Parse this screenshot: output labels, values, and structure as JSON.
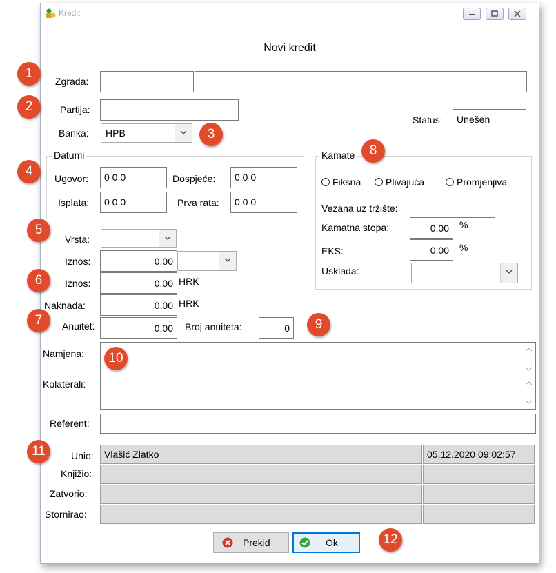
{
  "window": {
    "title": "Kredit",
    "heading": "Novi kredit"
  },
  "form": {
    "zgrada_label": "Zgrada:",
    "partija_label": "Partija:",
    "banka_label": "Banka:",
    "banka_value": "HPB",
    "status_label": "Status:",
    "status_value": "Unešen",
    "datumi": {
      "legend": "Datumi",
      "ugovor_label": "Ugovor:",
      "ugovor_value": "0 0 0",
      "dospjece_label": "Dospjeće:",
      "dospjece_value": "0 0 0",
      "isplata_label": "Isplata:",
      "isplata_value": "0 0 0",
      "prva_rata_label": "Prva rata:",
      "prva_rata_value": "0 0 0"
    },
    "kamate": {
      "legend": "Kamate",
      "radio_fiksna": "Fiksna",
      "radio_plivajuca": "Plivajuća",
      "radio_promjenjiva": "Promjenjiva",
      "vezana_label": "Vezana uz tržište:",
      "kamatna_stopa_label": "Kamatna stopa:",
      "kamatna_stopa_value": "0,00",
      "kamatna_unit": "%",
      "eks_label": "EKS:",
      "eks_value": "0,00",
      "eks_unit": "%",
      "usklada_label": "Usklada:"
    },
    "vrsta_label": "Vrsta:",
    "iznos1_label": "Iznos:",
    "iznos1_value": "0,00",
    "iznos2_label": "Iznos:",
    "iznos2_value": "0,00",
    "iznos2_unit": "HRK",
    "naknada_label": "Naknada:",
    "naknada_value": "0,00",
    "naknada_unit": "HRK",
    "anuitet_label": "Anuitet:",
    "anuitet_value": "0,00",
    "broj_anuiteta_label": "Broj anuiteta:",
    "broj_anuiteta_value": "0",
    "namjena_label": "Namjena:",
    "kolaterali_label": "Kolaterali:",
    "referent_label": "Referent:"
  },
  "audit": {
    "unio_label": "Unio:",
    "unio_name": "Vlašić Zlatko",
    "unio_time": "05.12.2020 09:02:57",
    "knjizio_label": "Knjižio:",
    "zatvorio_label": "Zatvorio:",
    "stornirao_label": "Stornirao:"
  },
  "buttons": {
    "prekid": "Prekid",
    "ok": "Ok"
  },
  "badges": [
    "1",
    "2",
    "3",
    "4",
    "5",
    "6",
    "7",
    "8",
    "9",
    "10",
    "11",
    "12"
  ],
  "colors": {
    "badge": "#e24a2c",
    "focus": "#0078d7",
    "readonly": "#dcdcdc"
  }
}
